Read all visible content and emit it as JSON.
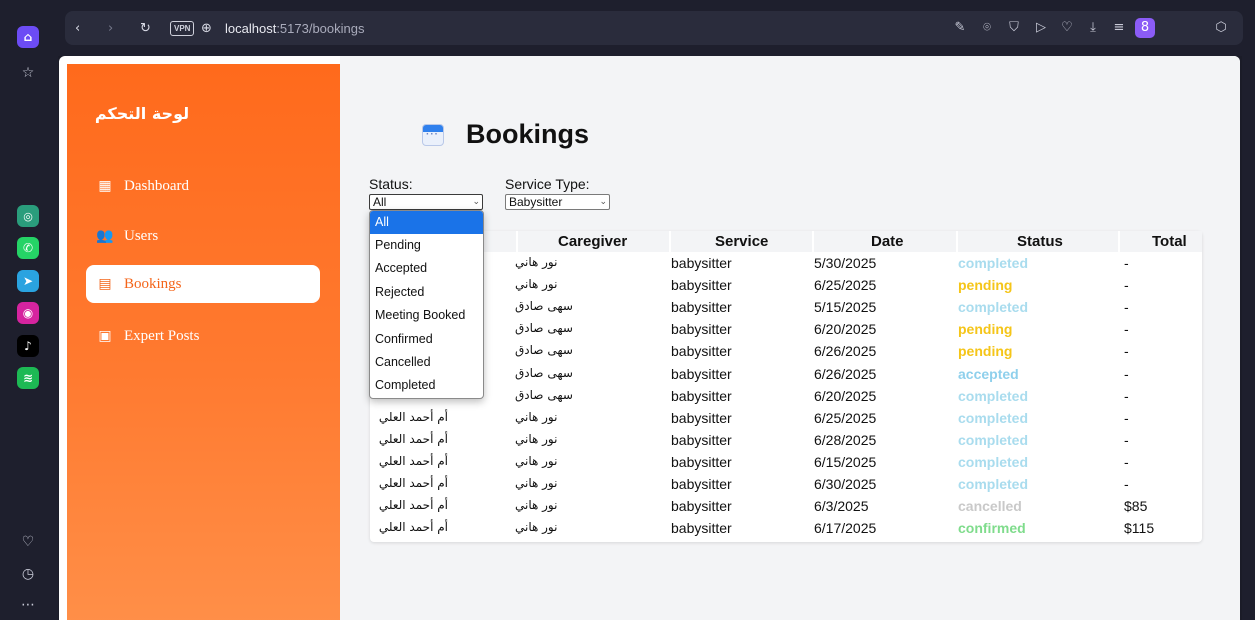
{
  "browser": {
    "url_host": "localhost",
    "url_path": ":5173/bookings",
    "vpn_label": "VPN"
  },
  "sidebar": {
    "title": "لوحة التحكم",
    "items": [
      {
        "label": "Dashboard",
        "icon": "dashboard-icon"
      },
      {
        "label": "Users",
        "icon": "users-icon"
      },
      {
        "label": "Bookings",
        "icon": "calendar-icon"
      },
      {
        "label": "Expert Posts",
        "icon": "post-add-icon"
      }
    ]
  },
  "page": {
    "title": "Bookings",
    "icon": "calendar-icon"
  },
  "filters": {
    "status_label": "Status:",
    "status_value": "All",
    "service_label": "Service Type:",
    "service_value": "Babysitter",
    "status_options": [
      "All",
      "Pending",
      "Accepted",
      "Rejected",
      "Meeting Booked",
      "Confirmed",
      "Cancelled",
      "Completed"
    ]
  },
  "table": {
    "headers": [
      "Caregiver",
      "Service",
      "Date",
      "Status",
      "Total"
    ],
    "rows": [
      {
        "parent": "",
        "caregiver": "نور هاني",
        "service": "babysitter",
        "date": "5/30/2025",
        "status": "completed",
        "total": "-"
      },
      {
        "parent": "",
        "caregiver": "نور هاني",
        "service": "babysitter",
        "date": "6/25/2025",
        "status": "pending",
        "total": "-"
      },
      {
        "parent": "",
        "caregiver": "سهى صادق",
        "service": "babysitter",
        "date": "5/15/2025",
        "status": "completed",
        "total": "-"
      },
      {
        "parent": "",
        "caregiver": "سهى صادق",
        "service": "babysitter",
        "date": "6/20/2025",
        "status": "pending",
        "total": "-"
      },
      {
        "parent": "",
        "caregiver": "سهى صادق",
        "service": "babysitter",
        "date": "6/26/2025",
        "status": "pending",
        "total": "-"
      },
      {
        "parent": "",
        "caregiver": "سهى صادق",
        "service": "babysitter",
        "date": "6/26/2025",
        "status": "accepted",
        "total": "-"
      },
      {
        "parent": "",
        "caregiver": "سهى صادق",
        "service": "babysitter",
        "date": "6/20/2025",
        "status": "completed",
        "total": "-"
      },
      {
        "parent": "أم أحمد العلي",
        "caregiver": "نور هاني",
        "service": "babysitter",
        "date": "6/25/2025",
        "status": "completed",
        "total": "-"
      },
      {
        "parent": "أم أحمد العلي",
        "caregiver": "نور هاني",
        "service": "babysitter",
        "date": "6/28/2025",
        "status": "completed",
        "total": "-"
      },
      {
        "parent": "أم أحمد العلي",
        "caregiver": "نور هاني",
        "service": "babysitter",
        "date": "6/15/2025",
        "status": "completed",
        "total": "-"
      },
      {
        "parent": "أم أحمد العلي",
        "caregiver": "نور هاني",
        "service": "babysitter",
        "date": "6/30/2025",
        "status": "completed",
        "total": "-"
      },
      {
        "parent": "أم أحمد العلي",
        "caregiver": "نور هاني",
        "service": "babysitter",
        "date": "6/3/2025",
        "status": "cancelled",
        "total": "$85"
      },
      {
        "parent": "أم أحمد العلي",
        "caregiver": "نور هاني",
        "service": "babysitter",
        "date": "6/17/2025",
        "status": "confirmed",
        "total": "$115"
      }
    ]
  },
  "status_colors": {
    "completed": "#a9dcee",
    "pending": "#f5c518",
    "accepted": "#8fd0ec",
    "cancelled": "#c9c9c9",
    "confirmed": "#7fdc8c"
  },
  "colors": {
    "sidebar_accent": "#ff6a1c",
    "dropdown_selected": "#1a73e8"
  }
}
